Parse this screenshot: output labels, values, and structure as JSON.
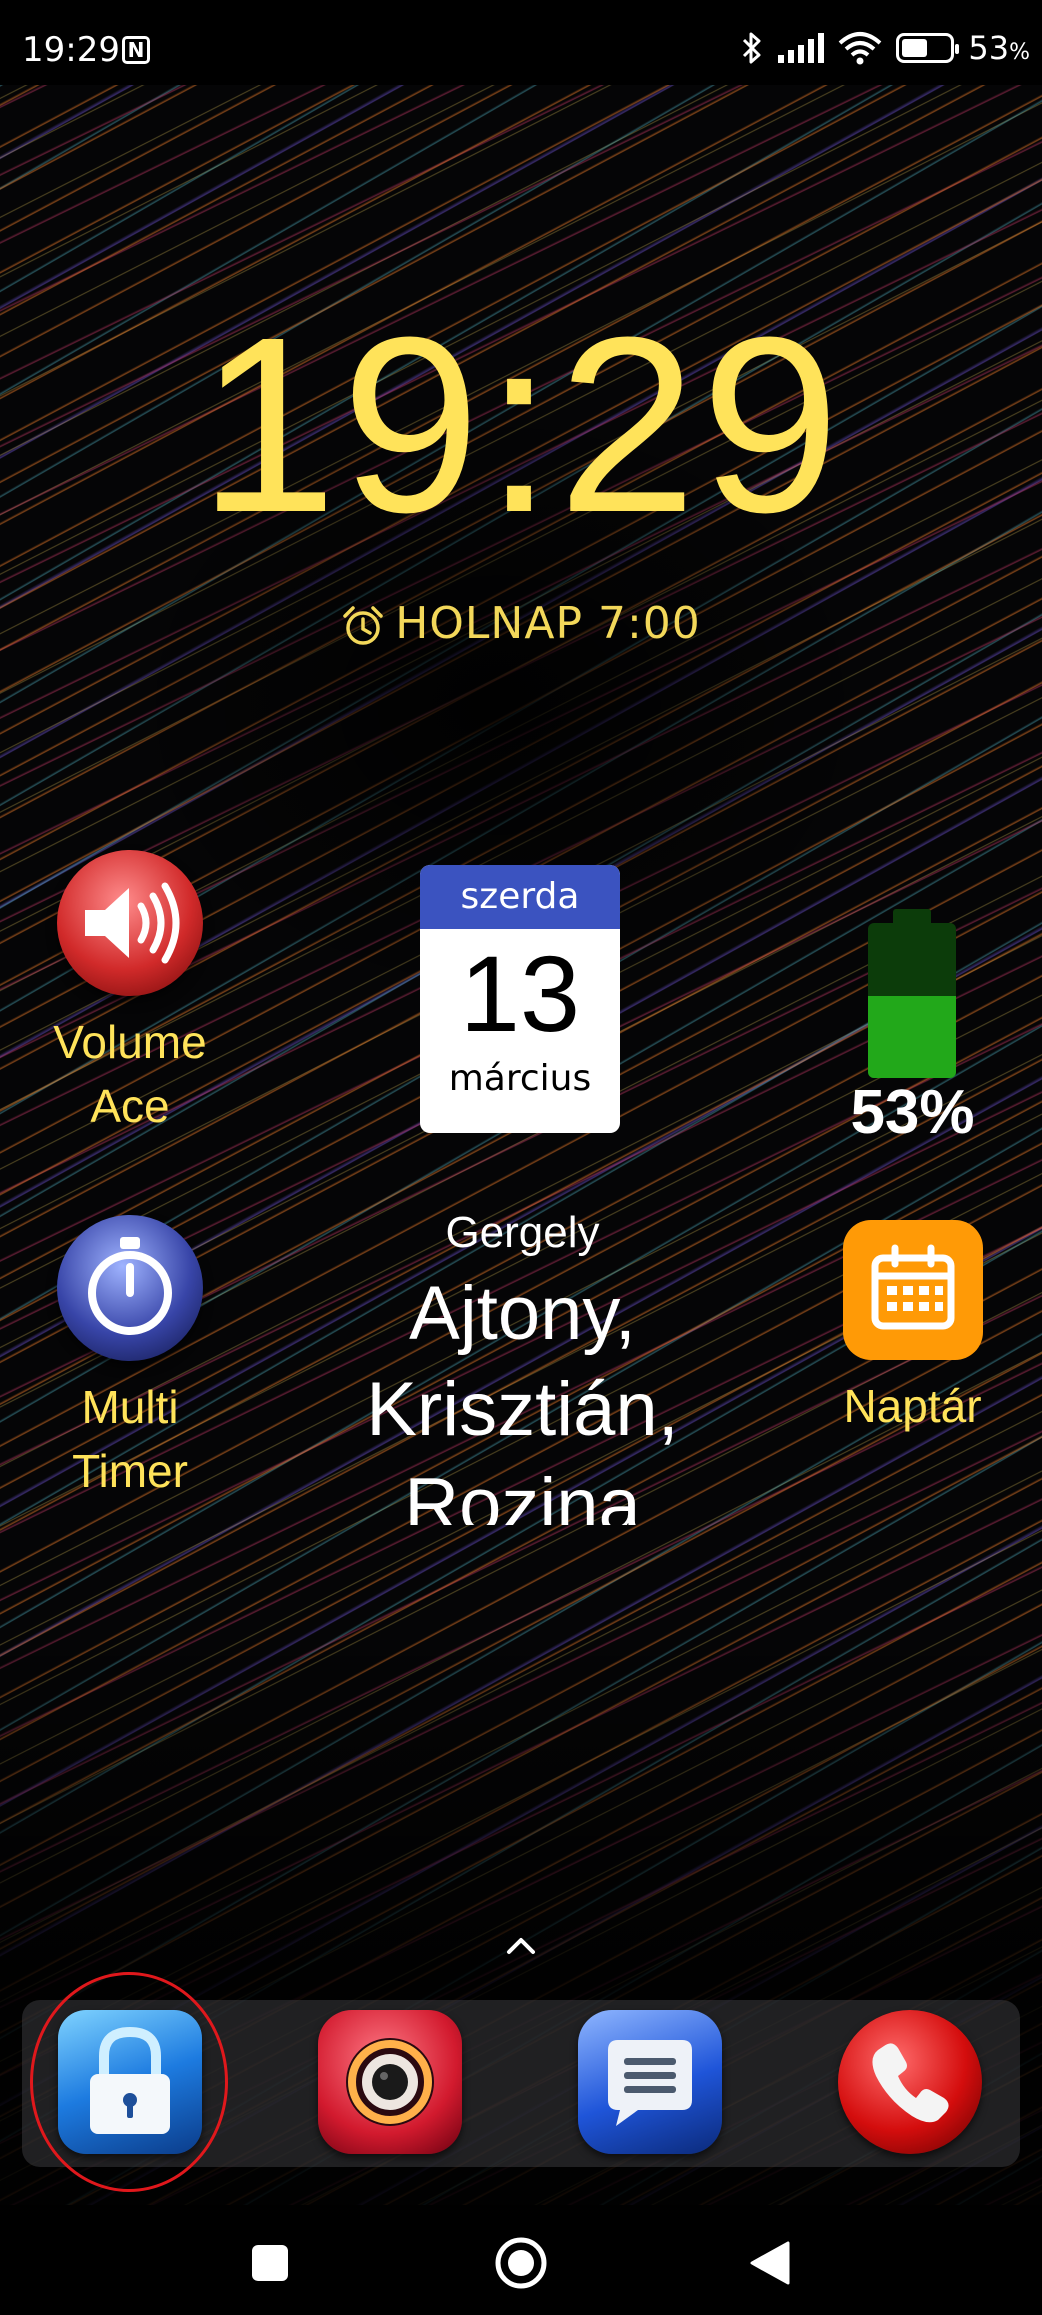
{
  "status_bar": {
    "time": "19:29",
    "nfc_icon": "N",
    "icons": [
      "bluetooth-icon",
      "signal-icon",
      "wifi-icon",
      "battery-icon"
    ],
    "battery_percent": "53",
    "battery_unit": "%",
    "battery_level": 0.53
  },
  "lockscreen": {
    "clock": "19:29",
    "alarm_text": "HOLNAP 7:00",
    "clock_color": "#ffe35a"
  },
  "widgets": {
    "volume_ace": {
      "line1": "Volume",
      "line2": "Ace",
      "icon": "speaker-icon"
    },
    "calendar": {
      "weekday": "szerda",
      "day": "13",
      "month": "március"
    },
    "battery": {
      "percent": "53%",
      "level": 0.53
    },
    "multi_timer": {
      "line1": "Multi",
      "line2": "Timer",
      "icon": "stopwatch-icon"
    },
    "namedays": {
      "label": "Gergely",
      "names": [
        "Ajtony,",
        "Krisztián,",
        "Rozina"
      ]
    },
    "naptar": {
      "label": "Naptár",
      "icon": "calendar-icon"
    }
  },
  "dock": {
    "apps": [
      {
        "name": "lock",
        "icon": "padlock-icon"
      },
      {
        "name": "camera",
        "icon": "camera-icon"
      },
      {
        "name": "messages",
        "icon": "message-icon"
      },
      {
        "name": "phone",
        "icon": "phone-icon"
      }
    ],
    "highlight_color": "#e0181c"
  },
  "nav": {
    "icons": [
      "recents-square-icon",
      "home-circle-icon",
      "back-triangle-icon"
    ]
  }
}
